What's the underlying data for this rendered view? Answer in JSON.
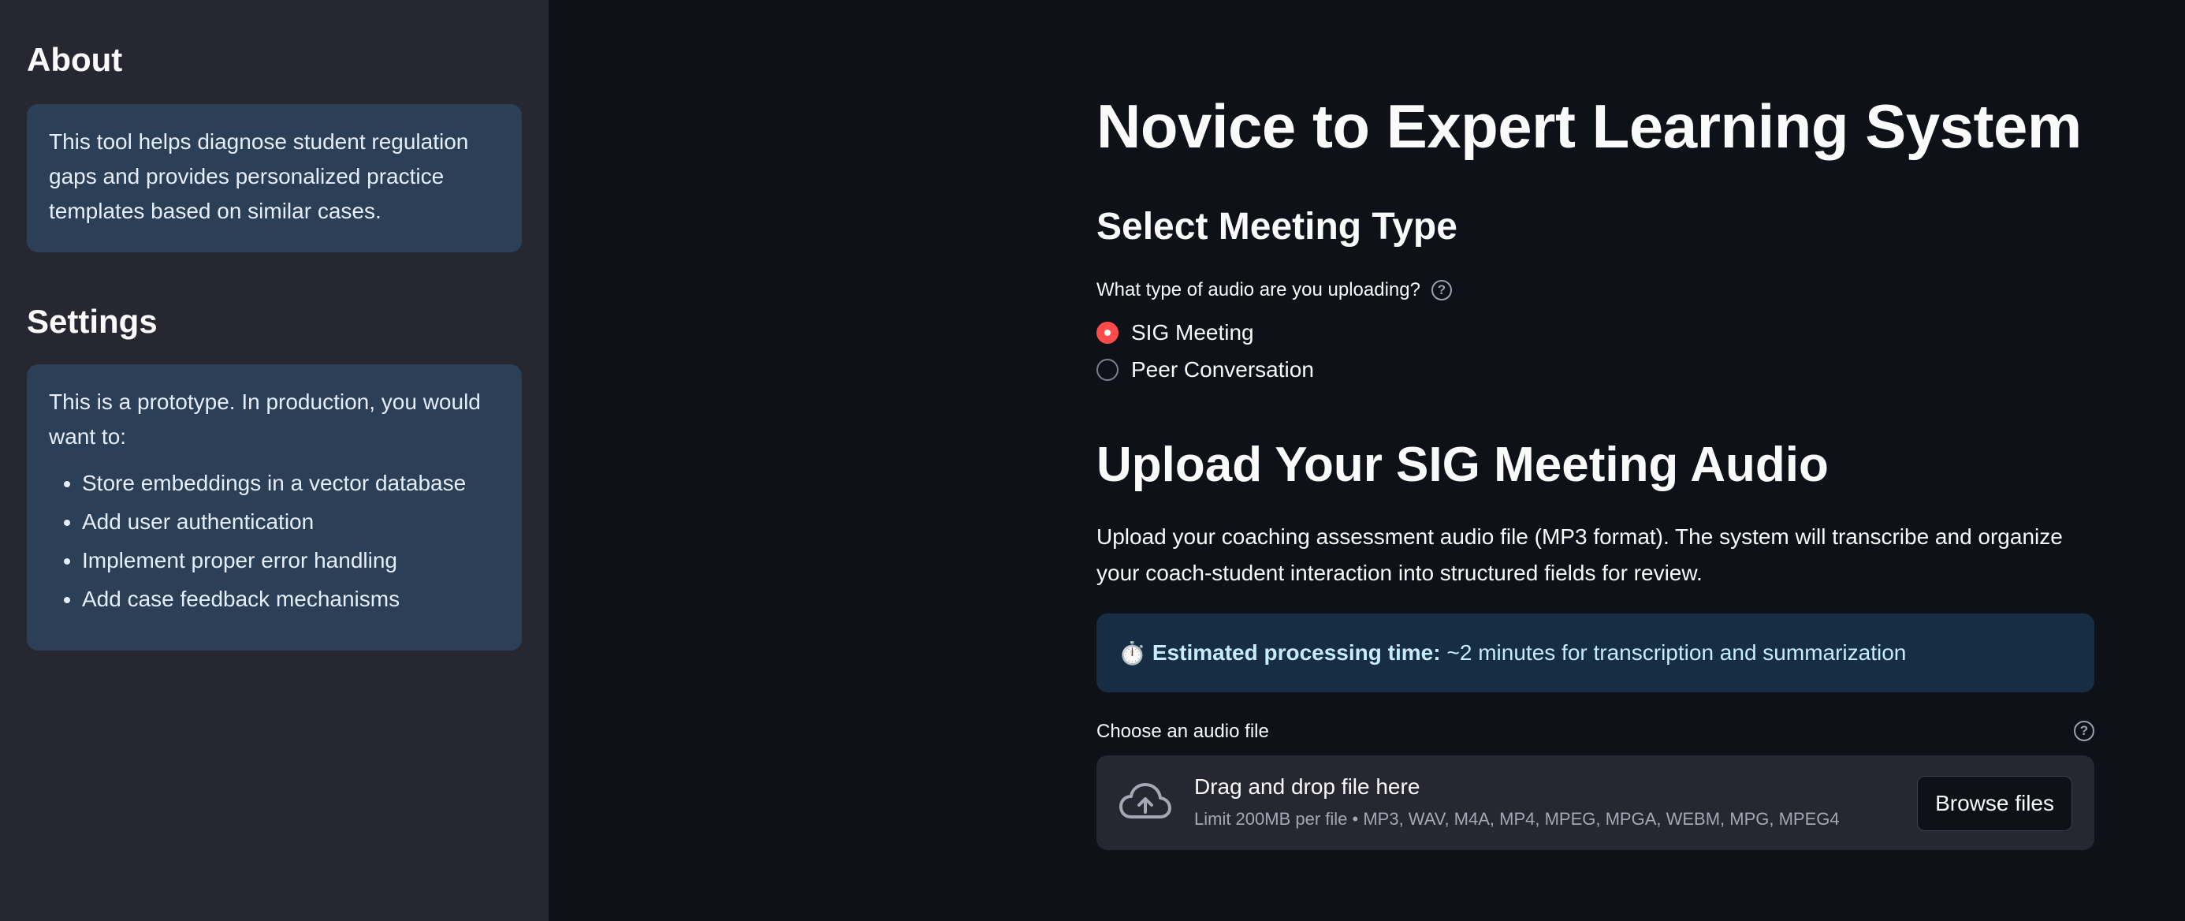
{
  "sidebar": {
    "about": {
      "title": "About",
      "text": "This tool helps diagnose student regulation gaps and provides personalized practice templates based on similar cases."
    },
    "settings": {
      "title": "Settings",
      "intro": "This is a prototype. In production, you would want to:",
      "items": [
        "Store embeddings in a vector database",
        "Add user authentication",
        "Implement proper error handling",
        "Add case feedback mechanisms"
      ]
    }
  },
  "main": {
    "title": "Novice to Expert Learning System",
    "select_heading": "Select Meeting Type",
    "radio_label": "What type of audio are you uploading?",
    "radio_options": [
      {
        "label": "SIG Meeting",
        "selected": true
      },
      {
        "label": "Peer Conversation",
        "selected": false
      }
    ],
    "upload_heading": "Upload Your SIG Meeting Audio",
    "description": "Upload your coaching assessment audio file (MP3 format). The system will transcribe and organize your coach-student interaction into structured fields for review.",
    "info": {
      "icon": "⏱️",
      "bold": "Estimated processing time:",
      "text": "~2 minutes for transcription and summarization"
    },
    "uploader": {
      "label": "Choose an audio file",
      "drop_title": "Drag and drop file here",
      "limit": "Limit 200MB per file • MP3, WAV, M4A, MP4, MPEG, MPGA, WEBM, MPG, MPEG4",
      "button": "Browse files"
    }
  },
  "colors": {
    "background": "#0e1117",
    "sidebar": "#262730",
    "sidebar_box": "#2b3f57",
    "info_box": "#172d43",
    "accent": "#ff4b4b"
  },
  "icons": [
    "help-icon",
    "stopwatch-icon",
    "cloud-upload-icon"
  ]
}
